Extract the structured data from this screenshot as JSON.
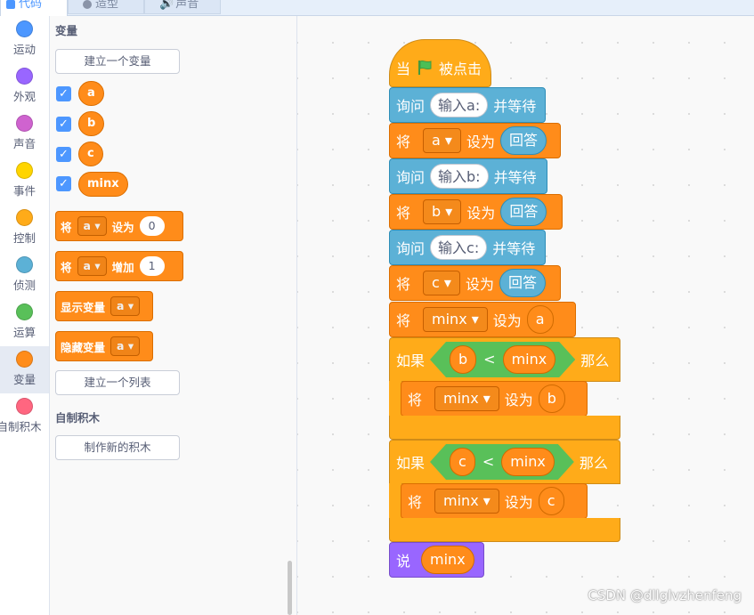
{
  "tabs": [
    "代码",
    "造型",
    "声音"
  ],
  "categories": [
    {
      "label": "运动",
      "color": "#4c97ff"
    },
    {
      "label": "外观",
      "color": "#9966ff"
    },
    {
      "label": "声音",
      "color": "#cf63cf"
    },
    {
      "label": "事件",
      "color": "#ffd500"
    },
    {
      "label": "控制",
      "color": "#ffab19"
    },
    {
      "label": "侦测",
      "color": "#5cb1d6"
    },
    {
      "label": "运算",
      "color": "#59c059"
    },
    {
      "label": "变量",
      "color": "#ff8c1a"
    },
    {
      "label": "自制积木",
      "color": "#ff6680"
    }
  ],
  "palette": {
    "variables_heading": "变量",
    "make_variable_button": "建立一个变量",
    "variables": [
      "a",
      "b",
      "c",
      "minx"
    ],
    "set_block": {
      "set": "将",
      "var": "a",
      "to": "设为",
      "value": "0"
    },
    "change_block": {
      "set": "将",
      "var": "a",
      "by": "增加",
      "value": "1"
    },
    "show_block": {
      "label": "显示变量",
      "var": "a"
    },
    "hide_block": {
      "label": "隐藏变量",
      "var": "a"
    },
    "make_list_button": "建立一个列表",
    "myblocks_heading": "自制积木",
    "make_block_button": "制作新的积木"
  },
  "script": {
    "hat": {
      "when": "当",
      "clicked": "被点击"
    },
    "ask1": {
      "ask": "询问",
      "prompt": "输入a:",
      "wait": "并等待"
    },
    "set1": {
      "set": "将",
      "var": "a",
      "to": "设为",
      "value": "回答"
    },
    "ask2": {
      "ask": "询问",
      "prompt": "输入b:",
      "wait": "并等待"
    },
    "set2": {
      "set": "将",
      "var": "b",
      "to": "设为",
      "value": "回答"
    },
    "ask3": {
      "ask": "询问",
      "prompt": "输入c:",
      "wait": "并等待"
    },
    "set3": {
      "set": "将",
      "var": "c",
      "to": "设为",
      "value": "回答"
    },
    "set4": {
      "set": "将",
      "var": "minx",
      "to": "设为",
      "value": "a"
    },
    "if1": {
      "if": "如果",
      "left": "b",
      "op": "<",
      "right": "minx",
      "then": "那么"
    },
    "if1_body": {
      "set": "将",
      "var": "minx",
      "to": "设为",
      "value": "b"
    },
    "if2": {
      "if": "如果",
      "left": "c",
      "op": "<",
      "right": "minx",
      "then": "那么"
    },
    "if2_body": {
      "set": "将",
      "var": "minx",
      "to": "设为",
      "value": "c"
    },
    "say": {
      "say": "说",
      "value": "minx"
    }
  },
  "watermark": "CSDN @dllglvzhenfeng"
}
